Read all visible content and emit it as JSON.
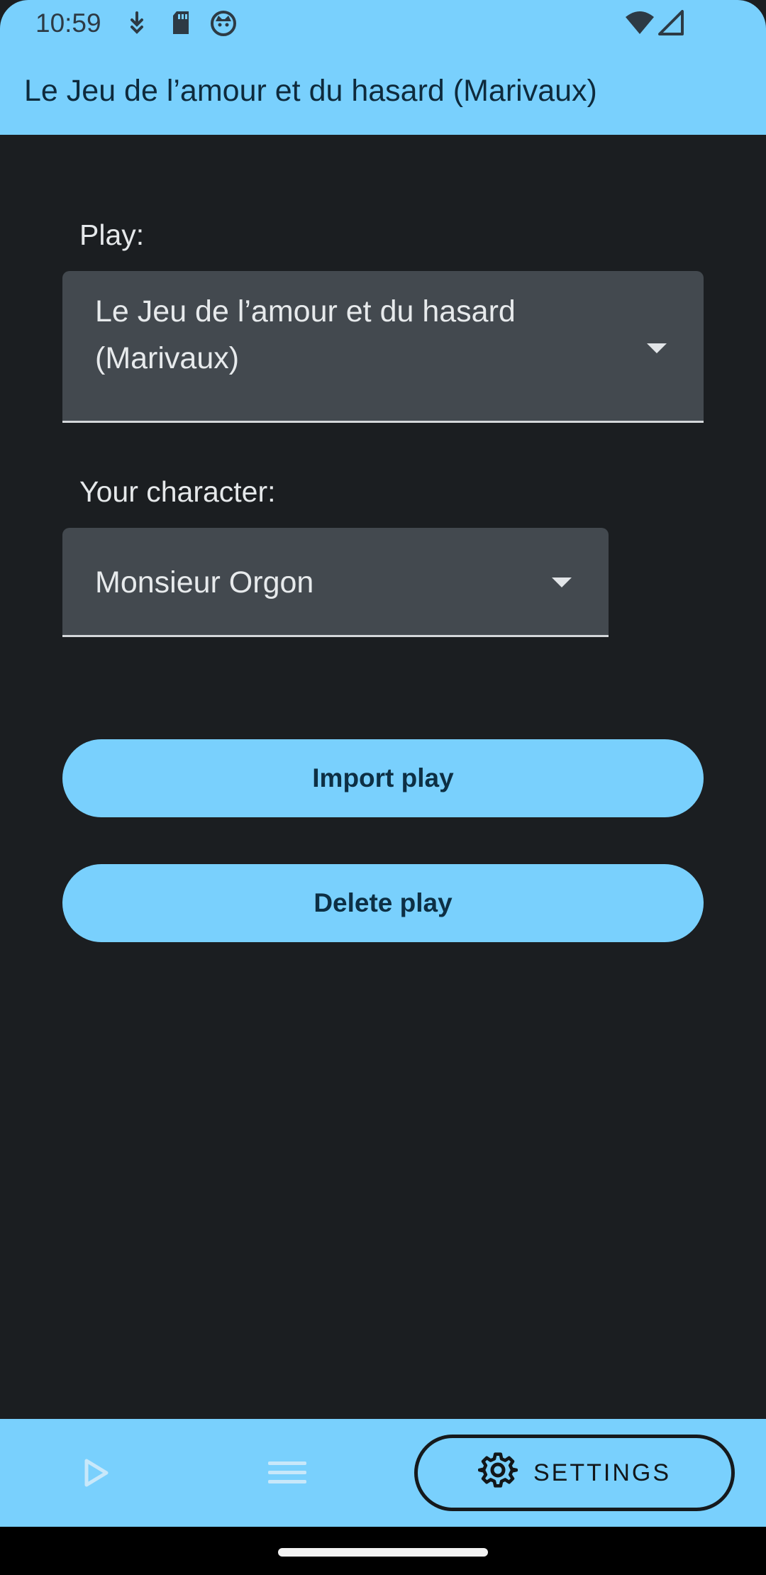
{
  "status_bar": {
    "time": "10:59",
    "left_icons": [
      "download-icon",
      "sd-card-icon",
      "cat-face-icon"
    ],
    "right_icons": [
      "wifi-icon",
      "cell-signal-icon"
    ]
  },
  "app_bar": {
    "title": "Le Jeu de l’amour et du hasard (Marivaux)"
  },
  "form": {
    "play_label": "Play:",
    "play_value_line1": "Le Jeu de l’amour et du hasard",
    "play_value_line2": "(Marivaux)",
    "character_label": "Your character:",
    "character_value": "Monsieur Orgon"
  },
  "actions": {
    "import_label": "Import play",
    "delete_label": "Delete play"
  },
  "bottom_nav": {
    "play_icon": "play-outline-icon",
    "list_icon": "menu-icon",
    "settings_label": "SETTINGS",
    "settings_icon": "gear-icon"
  },
  "colors": {
    "accent": "#79d0fd",
    "background": "#1b1e21",
    "field": "#43494f"
  }
}
